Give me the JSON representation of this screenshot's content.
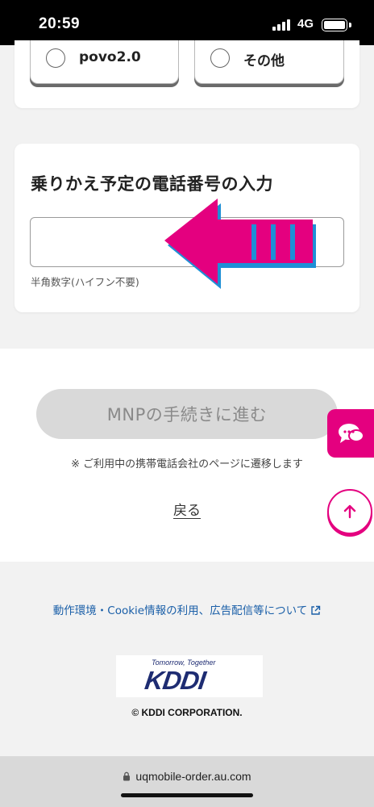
{
  "status_bar": {
    "time": "20:59",
    "network": "4G"
  },
  "carrier_options": [
    {
      "label": "povo2.0"
    },
    {
      "label": "その他"
    }
  ],
  "phone_section": {
    "title": "乗りかえ予定の電話番号の入力",
    "input_value": "",
    "hint": "半角数字(ハイフン不要)"
  },
  "actions": {
    "mnp_button": "MNPの手続きに進む",
    "mnp_note": "※ ご利用中の携帯電話会社のページに遷移します",
    "back_link": "戻る"
  },
  "footer": {
    "link": "動作環境・Cookie情報の利用、広告配信等について",
    "logo_tagline": "Tomorrow, Together",
    "logo_word": "KDDI",
    "copyright": "© KDDI CORPORATION."
  },
  "url_bar": {
    "url": "uqmobile-order.au.com"
  },
  "colors": {
    "accent": "#e4007f",
    "arrow_outline": "#1e8fd6",
    "link": "#1a5fa8",
    "kddi_navy": "#1e2c72"
  }
}
